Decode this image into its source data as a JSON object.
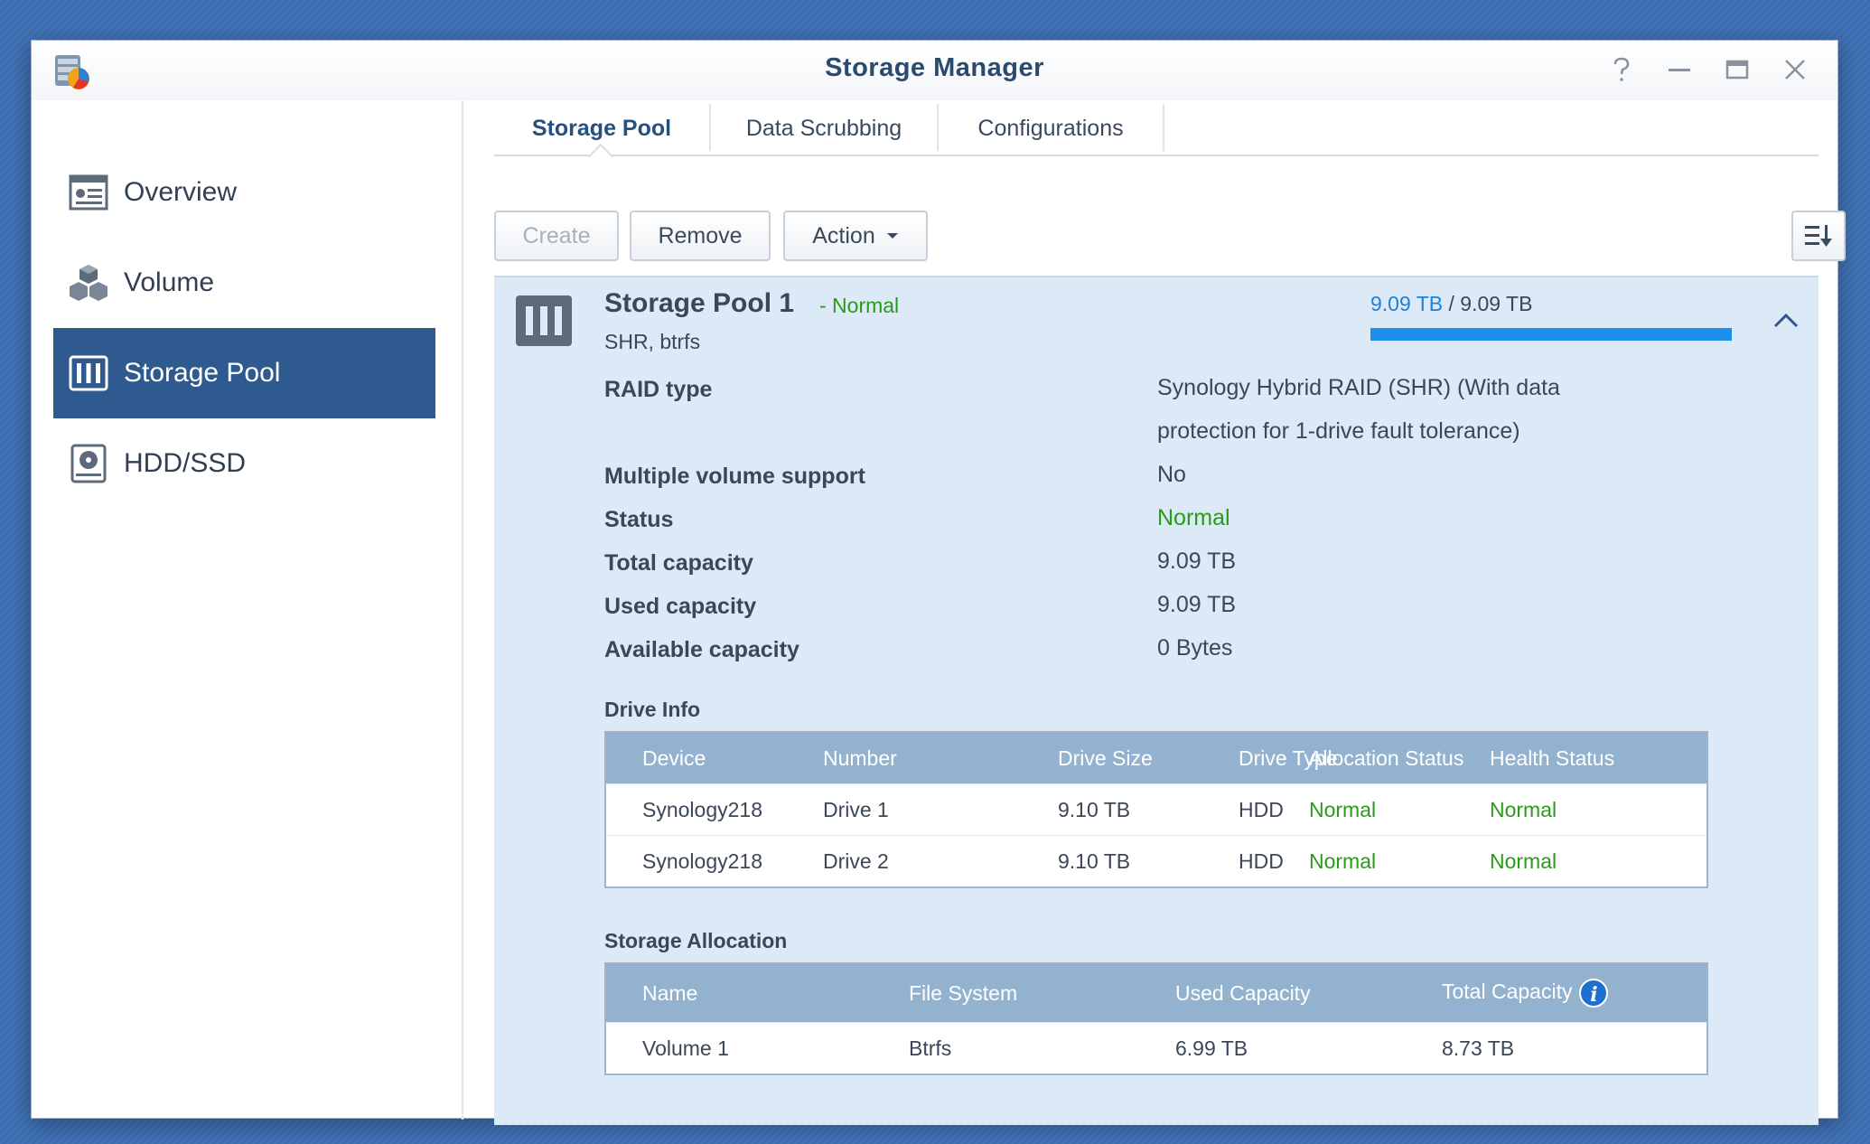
{
  "window": {
    "title": "Storage Manager"
  },
  "sidebar": {
    "items": [
      {
        "label": "Overview",
        "icon": "overview-icon",
        "active": false
      },
      {
        "label": "Volume",
        "icon": "volume-cubes-icon",
        "active": false
      },
      {
        "label": "Storage Pool",
        "icon": "storage-pool-icon",
        "active": true
      },
      {
        "label": "HDD/SSD",
        "icon": "hdd-icon",
        "active": false
      }
    ]
  },
  "tabs": [
    {
      "label": "Storage Pool",
      "active": true
    },
    {
      "label": "Data Scrubbing",
      "active": false
    },
    {
      "label": "Configurations",
      "active": false
    }
  ],
  "toolbar": {
    "create_label": "Create",
    "remove_label": "Remove",
    "action_label": "Action"
  },
  "pool": {
    "name": "Storage Pool 1",
    "status": "- Normal",
    "subtitle": "SHR, btrfs",
    "used": "9.09 TB",
    "total": "/ 9.09 TB",
    "usage_fraction": 1.0,
    "properties": [
      {
        "label": "RAID type",
        "value": "Synology Hybrid RAID (SHR) (With data protection for 1-drive fault tolerance)"
      },
      {
        "label": "Multiple volume support",
        "value": "No"
      },
      {
        "label": "Status",
        "value": "Normal"
      },
      {
        "label": "Total capacity",
        "value": "9.09 TB"
      },
      {
        "label": "Used capacity",
        "value": "9.09 TB"
      },
      {
        "label": "Available capacity",
        "value": "0 Bytes"
      }
    ]
  },
  "drive_info": {
    "title": "Drive Info",
    "headers": [
      "Device",
      "Number",
      "Drive Size",
      "Drive Type",
      "Allocation Status",
      "Health Status"
    ],
    "rows": [
      [
        "Synology218",
        "Drive 1",
        "9.10 TB",
        "HDD",
        "Normal",
        "Normal"
      ],
      [
        "Synology218",
        "Drive 2",
        "9.10 TB",
        "HDD",
        "Normal",
        "Normal"
      ]
    ]
  },
  "storage_allocation": {
    "title": "Storage Allocation",
    "headers": [
      "Name",
      "File System",
      "Used Capacity",
      "Total Capacity"
    ],
    "rows": [
      [
        "Volume 1",
        "Btrfs",
        "6.99 TB",
        "8.73 TB"
      ]
    ]
  },
  "colors": {
    "accent": "#2e5a8f",
    "normal_status": "#2a9a1a",
    "capacity_used": "#1d82d6"
  }
}
